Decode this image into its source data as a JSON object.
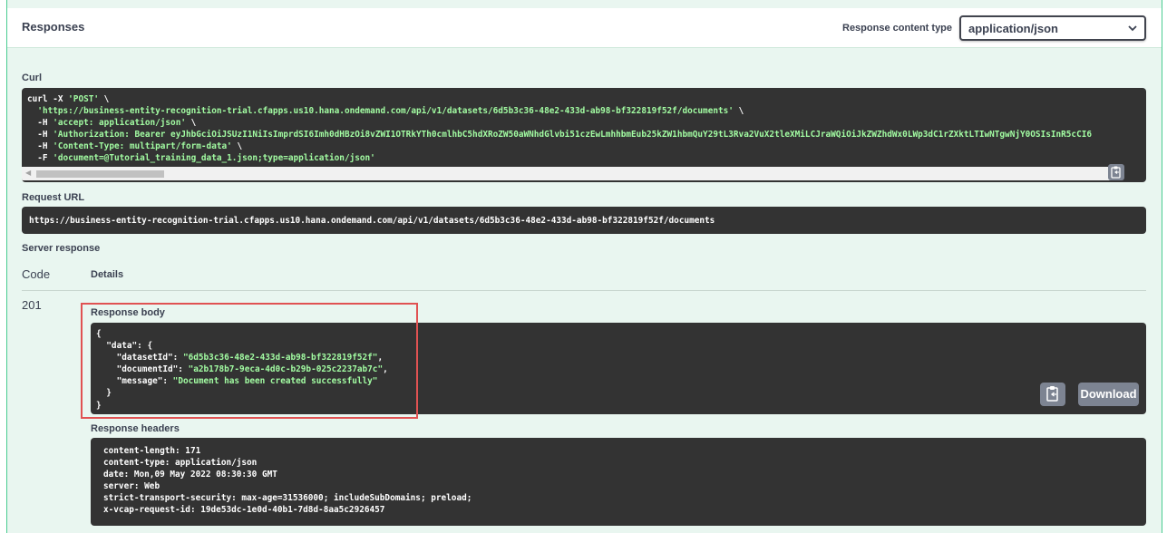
{
  "responses_header": {
    "title": "Responses",
    "content_type_label": "Response content type",
    "content_type_value": "application/json"
  },
  "curl": {
    "label": "Curl",
    "lines": [
      {
        "plain": "curl -X ",
        "str": "'POST'",
        "tail": " \\"
      },
      {
        "plain": "  ",
        "str": "'https://business-entity-recognition-trial.cfapps.us10.hana.ondemand.com/api/v1/datasets/6d5b3c36-48e2-433d-ab98-bf322819f52f/documents'",
        "tail": " \\"
      },
      {
        "plain": "  -H ",
        "str": "'accept: application/json'",
        "tail": " \\"
      },
      {
        "plain": "  -H ",
        "str": "'Authorization: Bearer eyJhbGciOiJSUzI1NiIsImprdSI6Imh0dHBzOi8vZWI1OTRkYTh0cmlhbC5hdXRoZW50aWNhdGlvbi51czEwLmhhbmEub25kZW1hbmQuY29tL3Rva2VuX2tleXMiLCJraWQiOiJkZWZhdWx0LWp3dC1rZXktLTIwNTgwNjY0OSIsInR5cCI6",
        "tail": ""
      },
      {
        "plain": "  -H ",
        "str": "'Content-Type: multipart/form-data'",
        "tail": " \\"
      },
      {
        "plain": "  -F ",
        "str": "'document=@Tutorial_training_data_1.json;type=application/json'",
        "tail": ""
      }
    ]
  },
  "request_url": {
    "label": "Request URL",
    "value": "https://business-entity-recognition-trial.cfapps.us10.hana.ondemand.com/api/v1/datasets/6d5b3c36-48e2-433d-ab98-bf322819f52f/documents"
  },
  "server_response": {
    "label": "Server response",
    "code_header": "Code",
    "details_header": "Details",
    "code": "201",
    "body_label": "Response body",
    "body": {
      "open": "{",
      "data_key": "  \"data\": {",
      "rows": [
        {
          "key": "    \"datasetId\": ",
          "val": "\"6d5b3c36-48e2-433d-ab98-bf322819f52f\"",
          "tail": ","
        },
        {
          "key": "    \"documentId\": ",
          "val": "\"a2b178b7-9eca-4d0c-b29b-025c2237ab7c\"",
          "tail": ","
        },
        {
          "key": "    \"message\": ",
          "val": "\"Document has been created successfully\"",
          "tail": ""
        }
      ],
      "data_close": "  }",
      "close": "}"
    },
    "download_label": "Download",
    "headers_label": "Response headers",
    "headers": [
      "content-length: 171",
      "content-type: application/json",
      "date: Mon,09 May 2022 08:30:30 GMT",
      "server: Web",
      "strict-transport-security: max-age=31536000; includeSubDomains; preload;",
      "x-vcap-request-id: 19de53dc-1e0d-40b1-7d8d-8aa5c2926457"
    ]
  },
  "colors": {
    "accent_green": "#49cc90",
    "panel_bg": "#e9f6f0",
    "code_bg": "#333333",
    "string_green": "#a2fca2",
    "highlight_red": "#e05252"
  }
}
